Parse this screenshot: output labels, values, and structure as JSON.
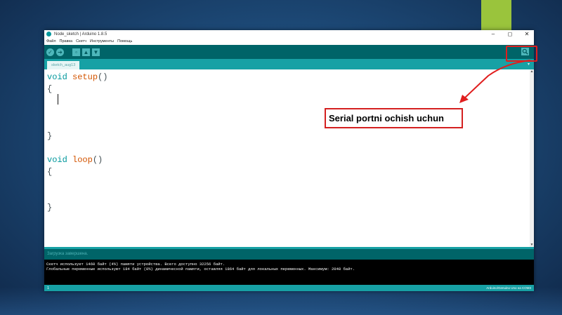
{
  "window": {
    "title": "Node_sketch | Arduino 1.8.5",
    "controls": {
      "minimize": "–",
      "maximize": "◻",
      "close": "✕"
    }
  },
  "menu": [
    "Файл",
    "Правка",
    "Скетч",
    "Инструменты",
    "Помощь"
  ],
  "toolbar": {
    "verify_icon": "✓",
    "upload_icon": "➔",
    "new_icon": "▫",
    "open_icon": "▲",
    "save_icon": "▼",
    "serial_monitor_icon": "magnifier-icon"
  },
  "tabs": [
    {
      "label": "sketch_aug13"
    }
  ],
  "editor": {
    "lines": [
      "void setup()",
      "{",
      "",
      "",
      "}",
      "",
      "void loop()",
      "{",
      "",
      "}"
    ]
  },
  "status": {
    "text": "Загрузка завершена."
  },
  "console": {
    "lines": [
      "Скетч использует 1460 байт (4%) памяти устройства. Всего доступно 32256 байт.",
      "Глобальные переменные используют 184 байт (8%) динамической памяти, оставляя 1864 байт для локальных переменных. Максимум: 2048 байт."
    ]
  },
  "bottom": {
    "line_number": "1",
    "board_info": "Arduino/Genuino Uno на COM3"
  },
  "annotation": {
    "text": "Serial portni ochish uchun"
  },
  "colors": {
    "toolbar": "#006468",
    "tabstrip": "#17a1a5",
    "keyword": "#00979c",
    "function": "#d35400",
    "annotation_red": "#e01e1e",
    "accent_green": "#9ac43c"
  }
}
